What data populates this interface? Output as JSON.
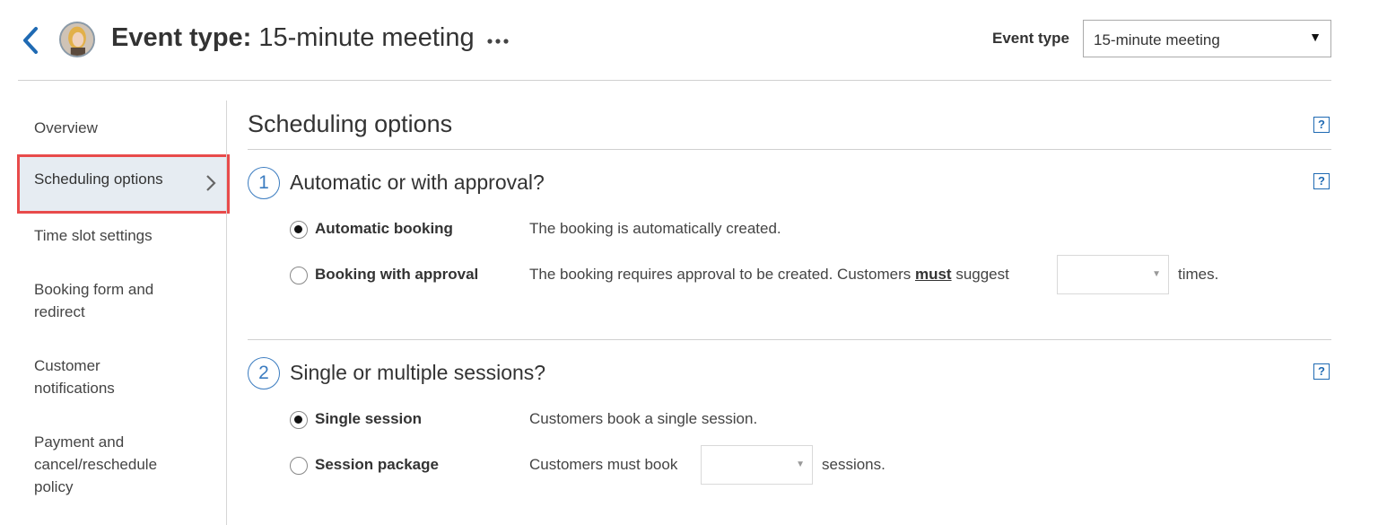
{
  "header": {
    "title_prefix": "Event type:",
    "title_value": "15-minute meeting",
    "event_type_label": "Event type",
    "event_type_selected": "15-minute meeting"
  },
  "sidebar": {
    "items": [
      {
        "label": "Overview"
      },
      {
        "label": "Scheduling options",
        "active": true
      },
      {
        "label": "Time slot settings"
      },
      {
        "label": "Booking form and redirect"
      },
      {
        "label": "Customer notifications"
      },
      {
        "label": "Payment and cancel/reschedule policy"
      }
    ]
  },
  "main": {
    "title": "Scheduling options",
    "help_glyph": "?",
    "sections": [
      {
        "number": "1",
        "title": "Automatic or with approval?",
        "options": [
          {
            "label": "Automatic booking",
            "desc": "The booking is automatically created.",
            "checked": true
          },
          {
            "label": "Booking with approval",
            "desc_before": "The booking requires approval to be created. Customers ",
            "desc_emph": "must",
            "desc_middle": " suggest",
            "select_value": "",
            "desc_after": "times.",
            "checked": false
          }
        ]
      },
      {
        "number": "2",
        "title": "Single or multiple sessions?",
        "options": [
          {
            "label": "Single session",
            "desc": "Customers book a single session.",
            "checked": true
          },
          {
            "label": "Session package",
            "desc_before": "Customers must book",
            "select_value": "",
            "desc_after": "sessions.",
            "checked": false
          }
        ]
      }
    ]
  },
  "colors": {
    "accent": "#1f6ab3",
    "highlight_border": "#e84b4b",
    "active_bg": "#e6ecf2"
  }
}
